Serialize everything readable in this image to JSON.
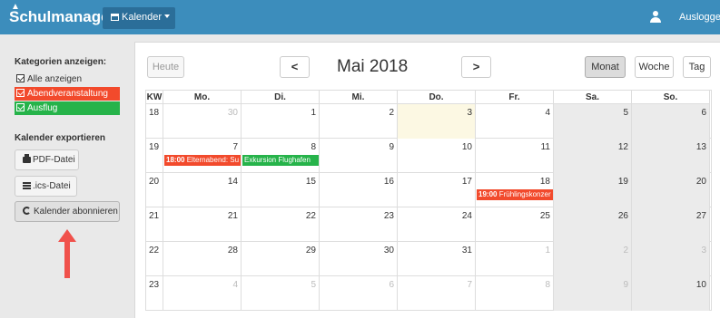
{
  "navbar": {
    "brand": "Schulmanager",
    "calendar_menu": "Kalender",
    "logout": "Ausloggen"
  },
  "sidebar": {
    "categories_title": "Kategorien anzeigen:",
    "categories": [
      {
        "label": "Alle anzeigen",
        "checked": true
      },
      {
        "label": "Abendveranstaltung",
        "checked": true,
        "color": "#f24a2c"
      },
      {
        "label": "Ausflug",
        "checked": true,
        "color": "#26b34a"
      }
    ],
    "export_title": "Kalender exportieren",
    "pdf_label": "PDF-Datei",
    "ics_label": ".ics-Datei",
    "subscribe_label": "Kalender abonnieren"
  },
  "toolbar": {
    "today_label": "Heute",
    "prev_label": "<",
    "next_label": ">",
    "title": "Mai 2018",
    "month_label": "Monat",
    "week_label": "Woche",
    "day_label": "Tag"
  },
  "calendar": {
    "headers": [
      "KW",
      "Mo.",
      "Di.",
      "Mi.",
      "Do.",
      "Fr.",
      "Sa.",
      "So."
    ],
    "weeks": [
      {
        "kw": "18",
        "days": [
          "30",
          "1",
          "2",
          "3",
          "4",
          "5",
          "6"
        ]
      },
      {
        "kw": "19",
        "days": [
          "7",
          "8",
          "9",
          "10",
          "11",
          "12",
          "13"
        ]
      },
      {
        "kw": "20",
        "days": [
          "14",
          "15",
          "16",
          "17",
          "18",
          "19",
          "20"
        ]
      },
      {
        "kw": "21",
        "days": [
          "21",
          "22",
          "23",
          "24",
          "25",
          "26",
          "27"
        ]
      },
      {
        "kw": "22",
        "days": [
          "28",
          "29",
          "30",
          "31",
          "1",
          "2",
          "3"
        ]
      },
      {
        "kw": "23",
        "days": [
          "4",
          "5",
          "6",
          "7",
          "8",
          "9",
          "10"
        ]
      }
    ],
    "events": [
      {
        "time": "18:00",
        "title": "Elternabend: Su",
        "week": 1,
        "day": 0,
        "category": "Abendveranstaltung"
      },
      {
        "time": "",
        "title": "Exkursion Flughafen",
        "week": 1,
        "day": 1,
        "category": "Ausflug"
      },
      {
        "time": "19:00",
        "title": "Frühlingskonzer",
        "week": 2,
        "day": 4,
        "category": "Abendveranstaltung"
      }
    ]
  },
  "colors": {
    "navbar": "#3c8dbc",
    "abendveranstaltung": "#f24a2c",
    "ausflug": "#26b34a",
    "today": "#fcf8e3",
    "weekend": "#ebebeb"
  }
}
